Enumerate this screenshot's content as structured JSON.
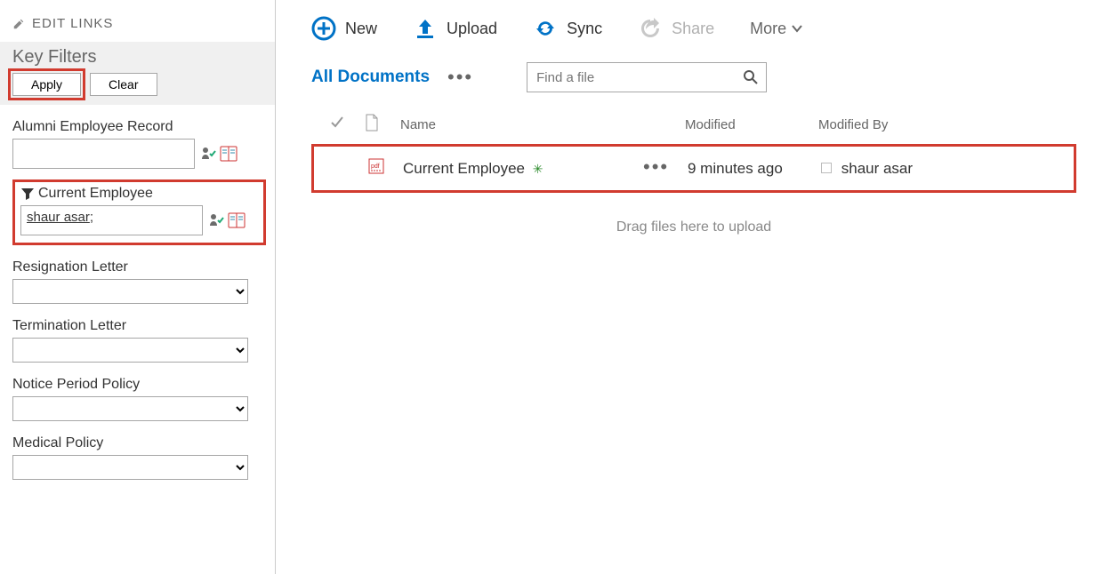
{
  "sidebar": {
    "edit_links_label": "EDIT LINKS",
    "key_filters_title": "Key Filters",
    "apply_label": "Apply",
    "clear_label": "Clear",
    "filters": {
      "alumni": {
        "label": "Alumni Employee Record",
        "value": ""
      },
      "current": {
        "label": "Current Employee",
        "value": "shaur asar"
      },
      "resignation": {
        "label": "Resignation Letter"
      },
      "termination": {
        "label": "Termination Letter"
      },
      "notice": {
        "label": "Notice Period Policy"
      },
      "medical": {
        "label": "Medical Policy"
      }
    }
  },
  "toolbar": {
    "new": "New",
    "upload": "Upload",
    "sync": "Sync",
    "share": "Share",
    "more": "More"
  },
  "viewbar": {
    "view": "All Documents",
    "search_placeholder": "Find a file"
  },
  "columns": {
    "name": "Name",
    "modified": "Modified",
    "modified_by": "Modified By"
  },
  "rows": [
    {
      "name": "Current Employee",
      "modified": "9 minutes ago",
      "modified_by": "shaur asar"
    }
  ],
  "drag_hint": "Drag files here to upload"
}
